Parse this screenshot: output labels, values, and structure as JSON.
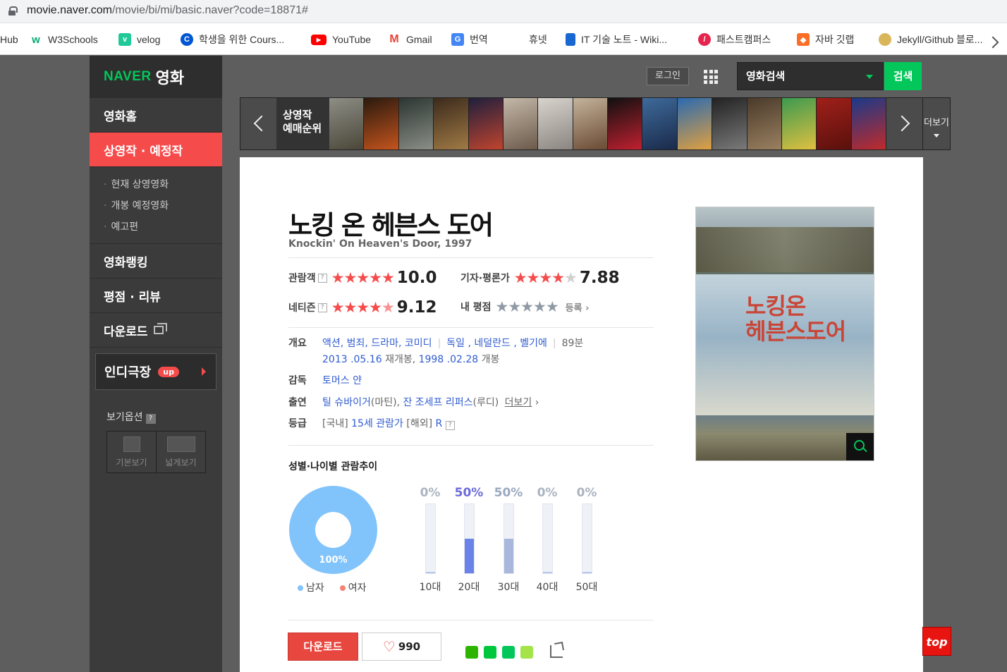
{
  "browser": {
    "url_host": "movie.naver.com",
    "url_path": "/movie/bi/mi/basic.naver?code=18871#",
    "bookmarks": [
      {
        "label": "Hub",
        "icon": "github-icon",
        "color": "#ffffff"
      },
      {
        "label": "W3Schools",
        "icon": "w3schools-icon",
        "color": "#04aa6d"
      },
      {
        "label": "velog",
        "icon": "velog-icon",
        "color": "#20c997"
      },
      {
        "label": "학생을 위한 Cours...",
        "icon": "coursera-icon",
        "color": "#0056d2"
      },
      {
        "label": "YouTube",
        "icon": "youtube-icon",
        "color": "#ff0000"
      },
      {
        "label": "Gmail",
        "icon": "gmail-icon",
        "color": "#ea4335"
      },
      {
        "label": "번역",
        "icon": "translate-icon",
        "color": "#4285f4"
      },
      {
        "label": "휴넷",
        "icon": "",
        "color": ""
      },
      {
        "label": "IT 기술 노트 - Wiki...",
        "icon": "wiki-icon",
        "color": "#1967d2"
      },
      {
        "label": "패스트캠퍼스",
        "icon": "fastcampus-icon",
        "color": "#e5254d"
      },
      {
        "label": "자바 깃랩",
        "icon": "gitlab-icon",
        "color": "#fc6d26"
      },
      {
        "label": "Jekyll/Github 블로...",
        "icon": "jekyll-icon",
        "color": "#d9b65a"
      }
    ]
  },
  "brand": {
    "naver": "NAVER",
    "movie": "영화"
  },
  "sidebar": {
    "items": [
      {
        "label": "영화홈"
      },
      {
        "label": "상영작 · 예정작"
      },
      {
        "label": "영화랭킹"
      },
      {
        "label": "평점 · 리뷰"
      },
      {
        "label": "다운로드"
      }
    ],
    "submenu": [
      "현재 상영영화",
      "개봉 예정영화",
      "예고편"
    ],
    "indie": {
      "label": "인디극장",
      "badge": "up"
    },
    "view_option": {
      "label": "보기옵션",
      "help": "?",
      "basic": "기본보기",
      "wide": "넓게보기"
    }
  },
  "topbar": {
    "login": "로그인",
    "search_label": "영화검색",
    "search_button": "검색"
  },
  "strip": {
    "label_line1": "상영작",
    "label_line2": "예매순위",
    "more": "더보기"
  },
  "movie": {
    "title": "노킹 온 헤븐스 도어",
    "subtitle": "Knockin' On Heaven's Door, 1997",
    "ratings": {
      "audience": {
        "label": "관람객",
        "score": "10.0",
        "stars": 5
      },
      "critic": {
        "label": "기자·평론가",
        "score": "7.88",
        "stars": 4
      },
      "netizen": {
        "label": "네티즌",
        "score": "9.12",
        "stars": 4.5
      },
      "mine": {
        "label": "내 평점",
        "register": "등록"
      }
    },
    "info": {
      "outline_key": "개요",
      "genres": "액션, 범죄, 드라마, 코미디",
      "countries": "독일 , 네덜란드 , 벨기에",
      "runtime": "89분",
      "rerelease": "2013 .05.16",
      "rerelease_suffix": "재개봉,",
      "release": "1998 .02.28",
      "release_suffix": "개봉",
      "director_key": "감독",
      "director": "토머스 얀",
      "cast_key": "출연",
      "cast1": "틸 슈바이거",
      "cast1_role": "(마틴),",
      "cast2": "잔 조세프 리퍼스",
      "cast2_role": "(루디)",
      "cast_more": "더보기",
      "grade_key": "등급",
      "grade_domestic_prefix": "[국내]",
      "grade_domestic": "15세 관람가",
      "grade_foreign_prefix": "[해외]",
      "grade_foreign": "R"
    },
    "trend": {
      "title": "성별·나이별 관람추이",
      "gender": {
        "male_pct": "100%",
        "male": "남자",
        "female": "여자",
        "male_color": "#81c3fb",
        "female_color": "#f58475"
      },
      "ages": [
        {
          "label": "10대",
          "pct": "0%",
          "value": 0
        },
        {
          "label": "20대",
          "pct": "50%",
          "value": 50
        },
        {
          "label": "30대",
          "pct": "50%",
          "value": 50
        },
        {
          "label": "40대",
          "pct": "0%",
          "value": 0
        },
        {
          "label": "50대",
          "pct": "0%",
          "value": 0
        }
      ]
    },
    "actions": {
      "download": "다운로드",
      "likes": "990"
    },
    "poster_title_line1": "노킹온",
    "poster_title_line2": "헤븐스도어"
  },
  "top_button": "top"
}
